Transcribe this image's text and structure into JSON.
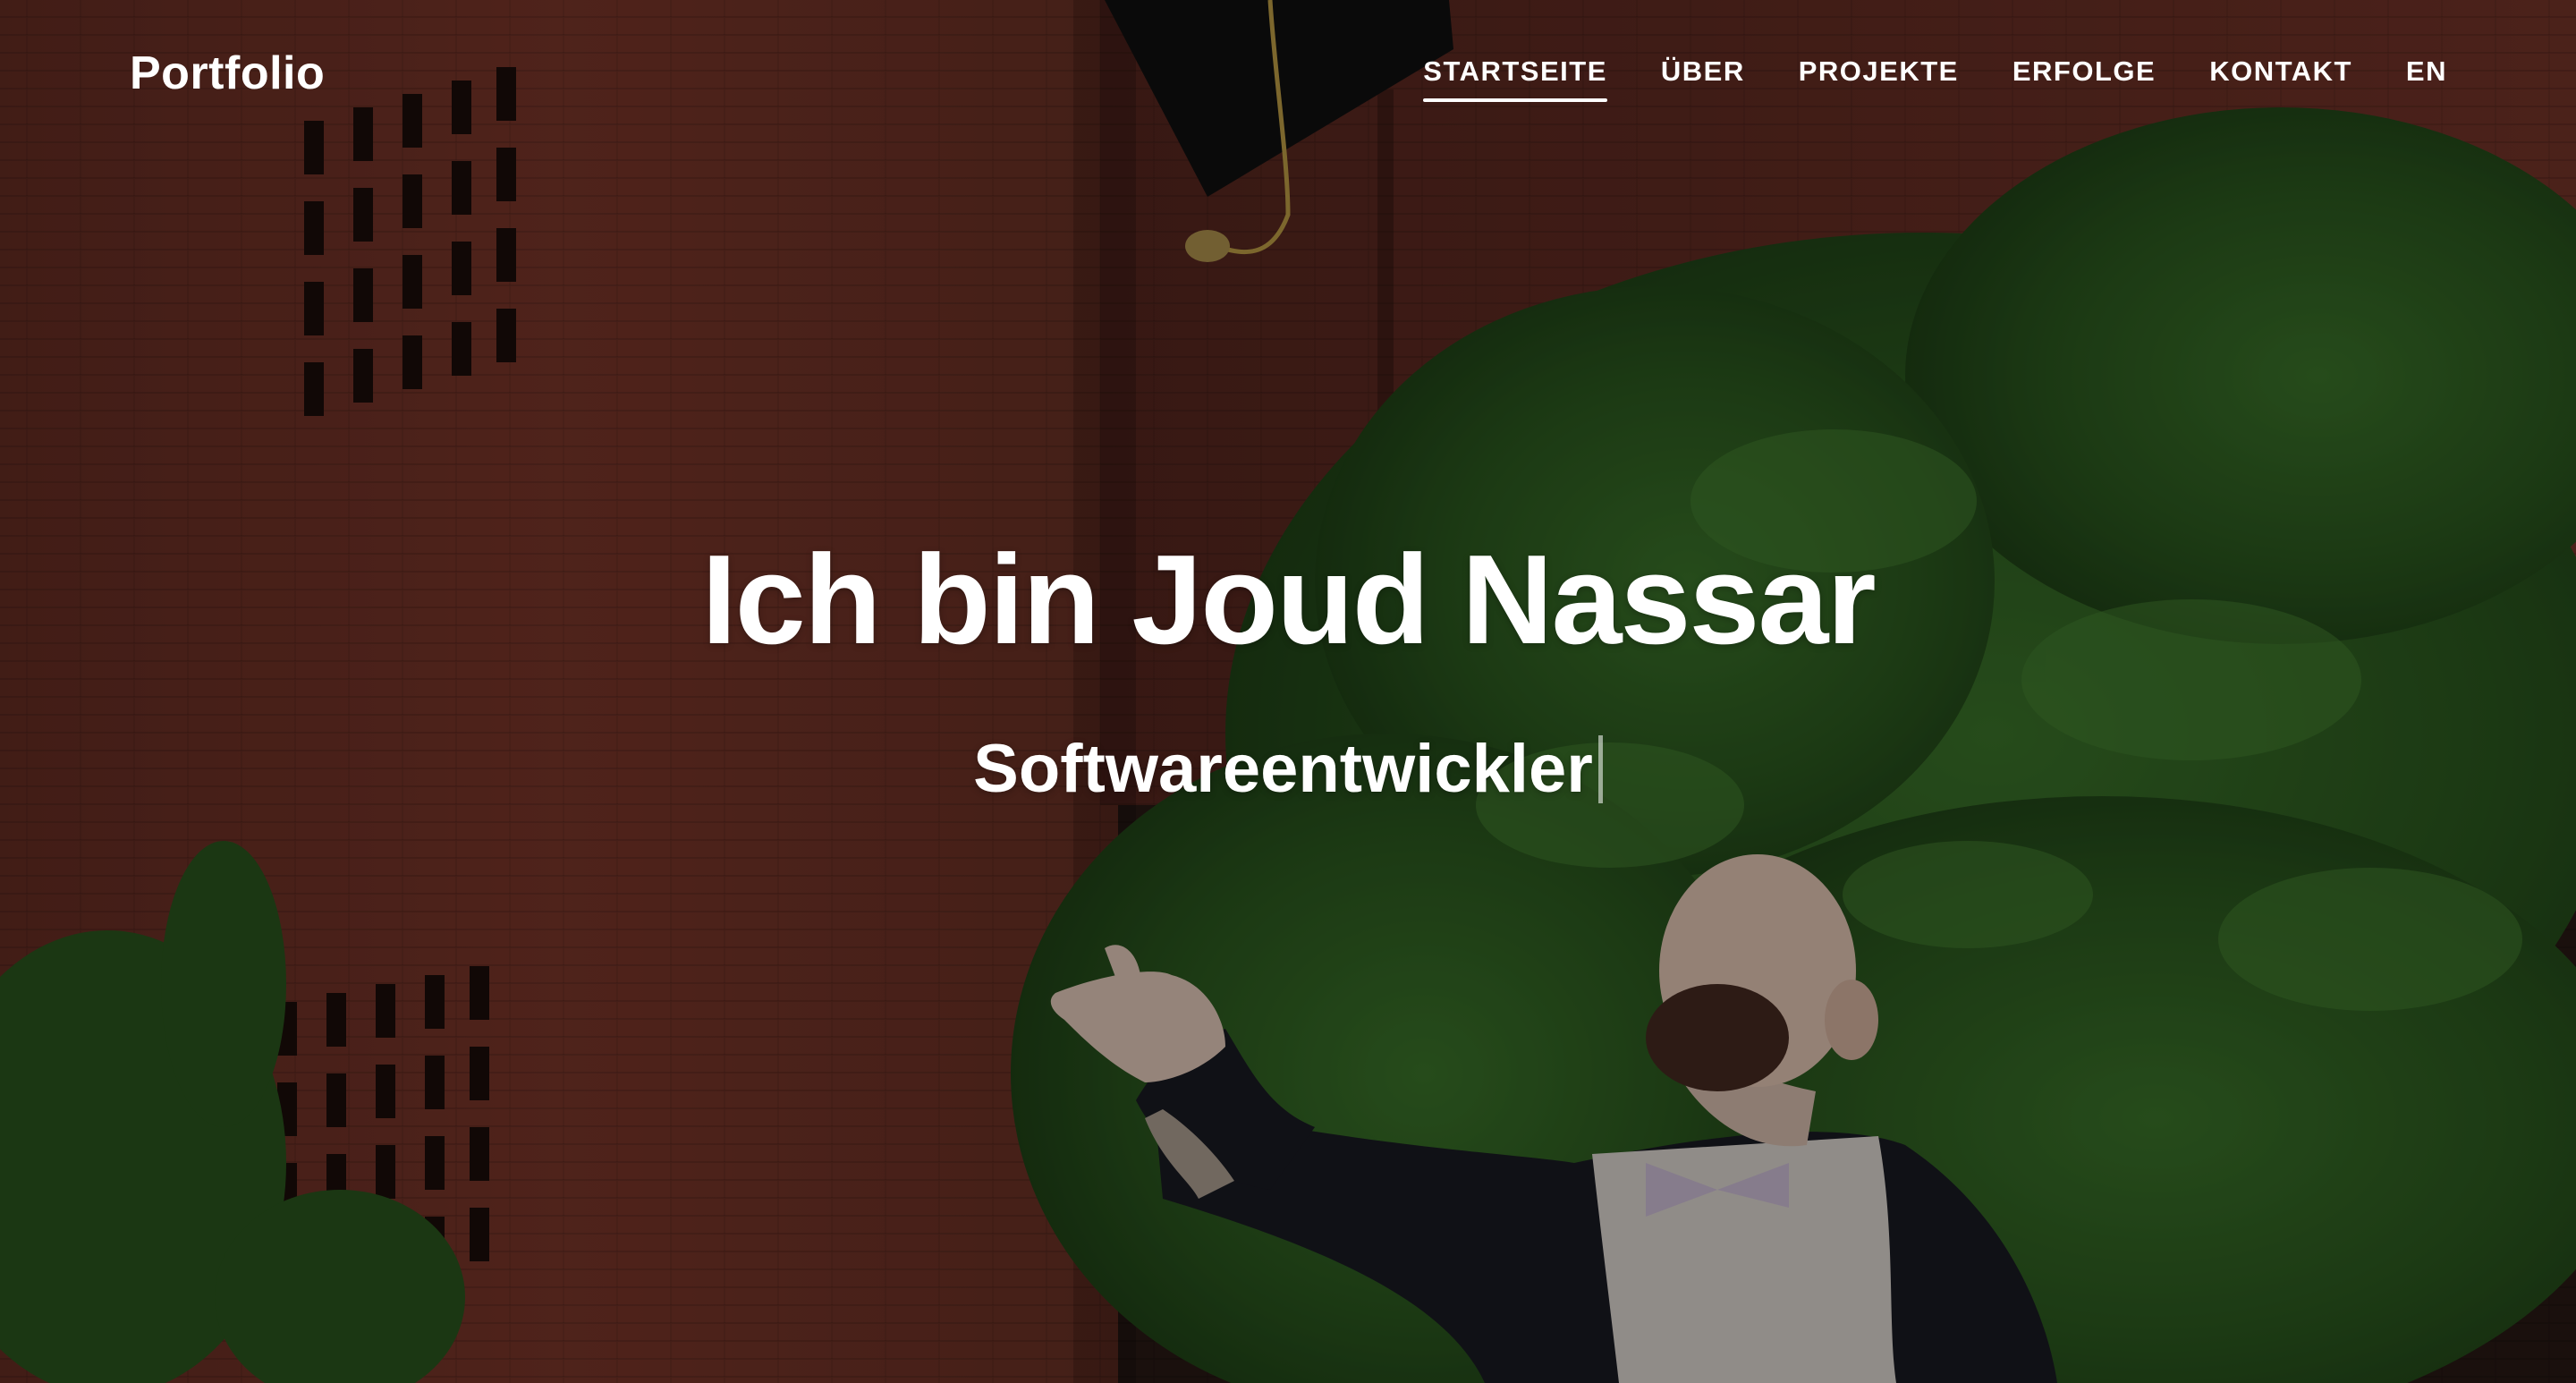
{
  "brand": {
    "name": "Portfolio"
  },
  "nav": {
    "items": [
      {
        "label": "STARTSEITE",
        "active": true
      },
      {
        "label": "ÜBER",
        "active": false
      },
      {
        "label": "PROJEKTE",
        "active": false
      },
      {
        "label": "ERFOLGE",
        "active": false
      },
      {
        "label": "KONTAKT",
        "active": false
      }
    ],
    "language_toggle": "EN"
  },
  "hero": {
    "title": "Ich bin Joud Nassar",
    "subtitle": "Softwareentwickler",
    "background": "graduate throwing cap in front of brick building and trees"
  },
  "colors": {
    "text": "#ffffff",
    "brick": "#7a3a2e",
    "foliage": "#2f5a22",
    "overlay": "rgba(0,0,0,0.38)"
  }
}
